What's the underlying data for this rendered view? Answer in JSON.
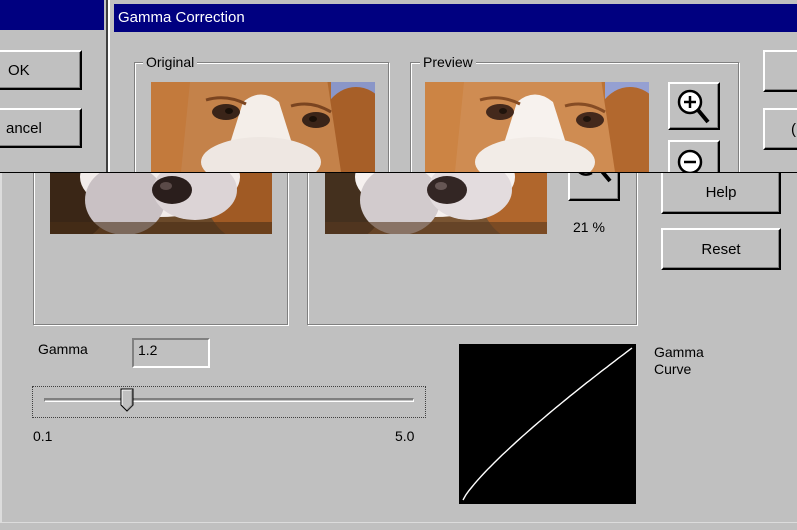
{
  "left_dialog": {
    "ok_label": "OK",
    "cancel_label": "ancel"
  },
  "main_dialog": {
    "title": "Gamma Correction",
    "groups": {
      "original_label": "Original",
      "preview_label": "Preview"
    },
    "zoom": {
      "in_icon": "zoom-in-icon",
      "out_icon": "zoom-out-icon",
      "level": "21 %"
    },
    "buttons": {
      "help_label": "Help",
      "reset_label": "Reset"
    },
    "gamma": {
      "label": "Gamma",
      "value": "1.2",
      "slider_min_label": "0.1",
      "slider_max_label": "5.0",
      "slider_min": 0.1,
      "slider_max": 5.0,
      "slider_value": 1.2
    },
    "curve": {
      "label_line1": "Gamma",
      "label_line2": "Curve",
      "background": "#000000",
      "line_color": "#ffffff"
    }
  },
  "colors": {
    "titlebar": "#000080",
    "face": "#c0c0c0"
  }
}
